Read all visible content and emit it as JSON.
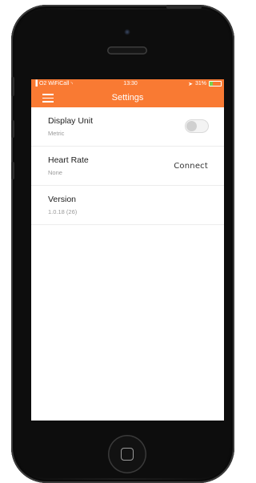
{
  "status_bar": {
    "carrier": "O2 WiFiCall",
    "time": "13:30",
    "battery": "31%",
    "battery_level": 0.31
  },
  "nav": {
    "title": "Settings",
    "menu_icon": "hamburger-menu-icon"
  },
  "settings": [
    {
      "title": "Display Unit",
      "subtitle": "Metric",
      "control": "toggle",
      "toggle_on": false
    },
    {
      "title": "Heart Rate",
      "subtitle": "None",
      "action": "Connect"
    },
    {
      "title": "Version",
      "subtitle": "1.0.18 (26)"
    }
  ],
  "colors": {
    "accent": "#f97a33",
    "battery_green": "#7bd24a"
  }
}
